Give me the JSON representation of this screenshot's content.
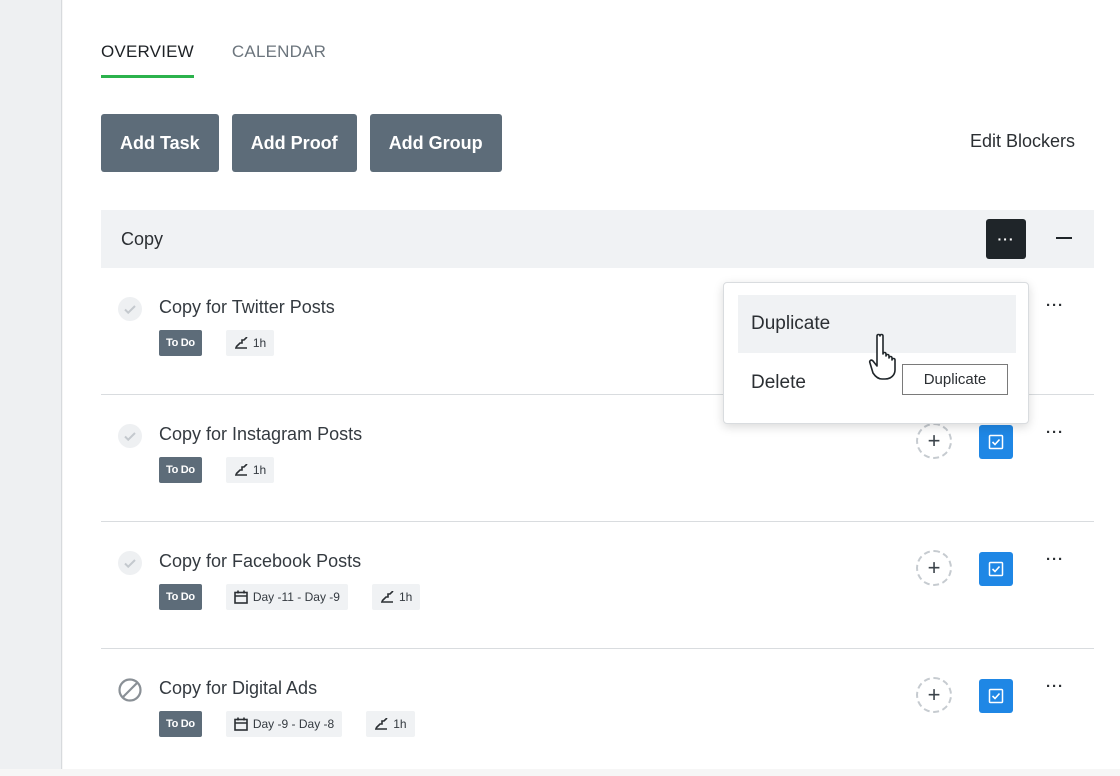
{
  "tabs": [
    {
      "label": "OVERVIEW",
      "active": true
    },
    {
      "label": "CALENDAR",
      "active": false
    }
  ],
  "toolbar": {
    "add_task": "Add Task",
    "add_proof": "Add Proof",
    "add_group": "Add Group",
    "edit_blockers": "Edit Blockers"
  },
  "group": {
    "title": "Copy",
    "menu_label": "···"
  },
  "tasks": [
    {
      "title": "Copy for Twitter Posts",
      "status": "To Do",
      "duration": "1h",
      "status_icon": "check-icon"
    },
    {
      "title": "Copy for Instagram Posts",
      "status": "To Do",
      "duration": "1h",
      "status_icon": "check-icon"
    },
    {
      "title": "Copy for Facebook Posts",
      "status": "To Do",
      "dates": "Day -11 - Day -9",
      "duration": "1h",
      "status_icon": "check-icon"
    },
    {
      "title": "Copy for Digital Ads",
      "status": "To Do",
      "dates": "Day -9 - Day -8",
      "duration": "1h",
      "status_icon": "blocked-icon"
    }
  ],
  "more_label": "···",
  "add_label": "+",
  "dropdown": {
    "items": [
      "Duplicate",
      "Delete"
    ]
  },
  "tooltip": "Duplicate",
  "colors": {
    "accent_green": "#2bb24c",
    "button_slate": "#5d6c79",
    "checklist_blue": "#1f87e5",
    "dark": "#1f2529"
  }
}
